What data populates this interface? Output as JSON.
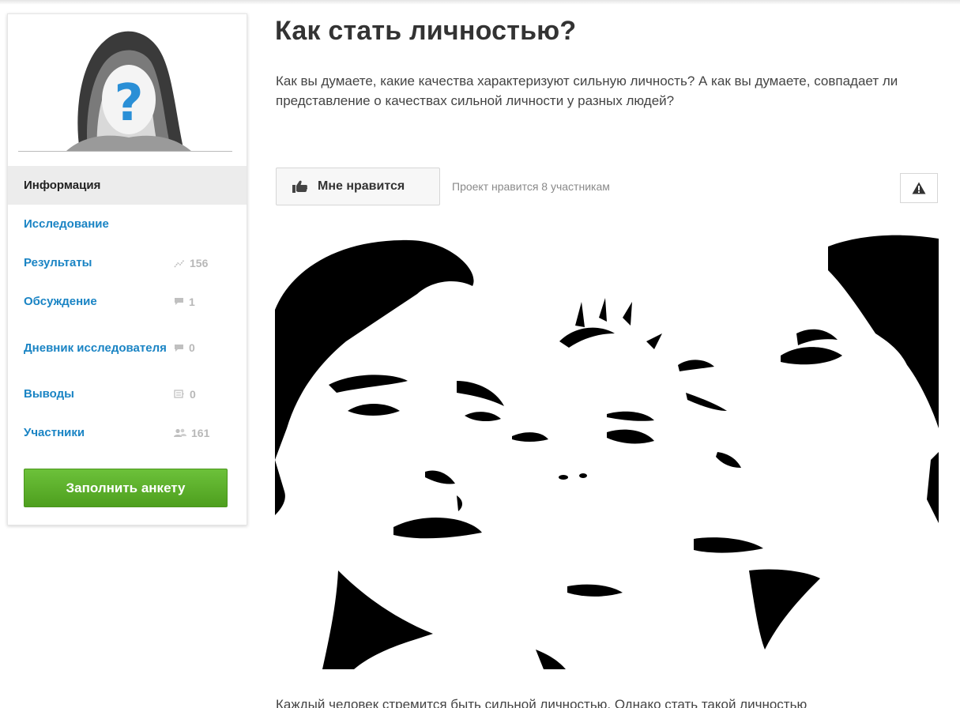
{
  "project": {
    "title": "Как стать личностью?",
    "intro": "Как вы думаете, какие качества характеризуют сильную личность? А как вы думаете, совпадает ли представление о качествах сильной личности у разных людей?",
    "description_partial": "Каждый человек стремится быть сильной личностью. Однако стать такой личностью"
  },
  "actions": {
    "like_label": "Мне нравится",
    "like_count_text": "Проект нравится 8 участникам",
    "like_icon": "thumbs-up-icon",
    "report_icon": "warning-icon"
  },
  "sidebar": {
    "items": [
      {
        "label": "Информация",
        "active": true,
        "count": "",
        "icon": ""
      },
      {
        "label": "Исследование",
        "active": false,
        "count": "",
        "icon": ""
      },
      {
        "label": "Результаты",
        "active": false,
        "count": "156",
        "icon": "chart-icon"
      },
      {
        "label": "Обсуждение",
        "active": false,
        "count": "1",
        "icon": "comment-icon"
      },
      {
        "label": "Дневник исследователя",
        "active": false,
        "count": "0",
        "icon": "comment-icon"
      },
      {
        "label": "Выводы",
        "active": false,
        "count": "0",
        "icon": "document-icon"
      },
      {
        "label": "Участники",
        "active": false,
        "count": "161",
        "icon": "users-icon"
      }
    ],
    "cta_label": "Заполнить анкету"
  },
  "colors": {
    "link": "#1a84c4",
    "cta": "#5cb02c",
    "active_bg": "#ececec",
    "avatar_question": "#2a8fd6"
  }
}
